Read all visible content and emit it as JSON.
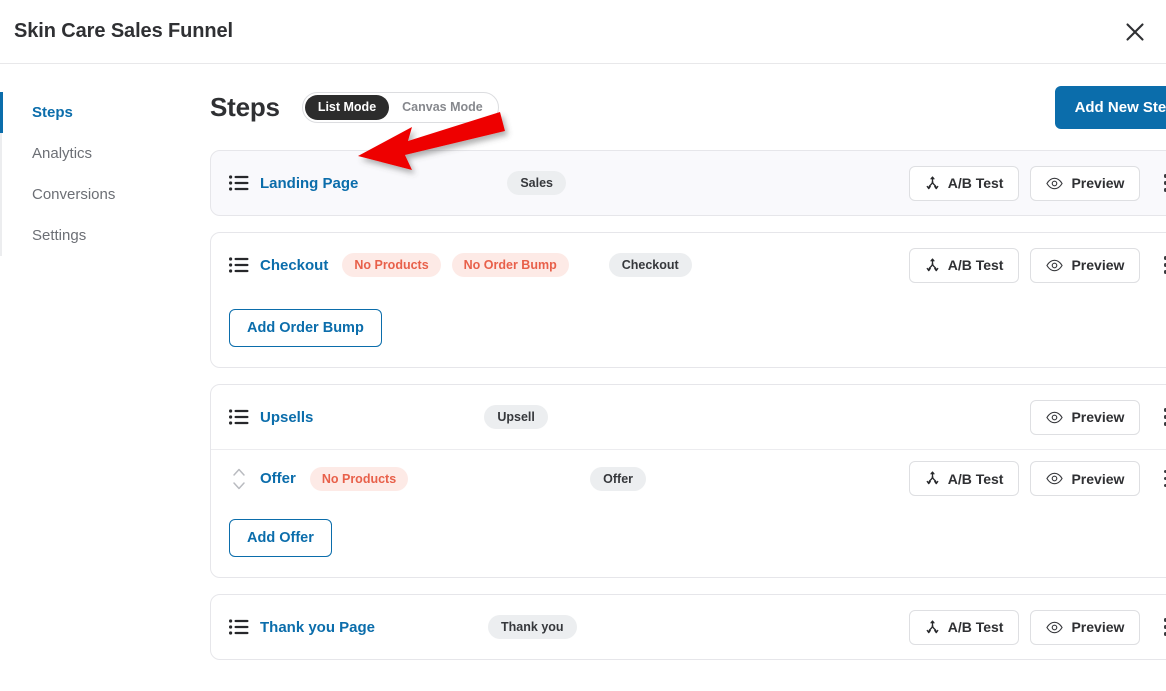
{
  "header": {
    "title": "Skin Care Sales Funnel",
    "close_icon": "close-icon"
  },
  "sidebar": {
    "items": [
      {
        "label": "Steps",
        "active": true
      },
      {
        "label": "Analytics",
        "active": false
      },
      {
        "label": "Conversions",
        "active": false
      },
      {
        "label": "Settings",
        "active": false
      }
    ]
  },
  "toolbar": {
    "page_title": "Steps",
    "mode_toggle": {
      "options": [
        "List Mode",
        "Canvas Mode"
      ],
      "selected": "List Mode"
    },
    "add_new_step_label": "Add New Step"
  },
  "labels": {
    "ab_test": "A/B Test",
    "preview": "Preview",
    "add_order_bump": "Add Order Bump",
    "add_offer": "Add Offer"
  },
  "steps": [
    {
      "name": "Landing Page",
      "type_badge": "Sales",
      "warnings": [],
      "handle_icon": "list-lines-icon",
      "has_ab_test": true,
      "has_preview": true,
      "highlight": true,
      "footer": null,
      "sub_rows": []
    },
    {
      "name": "Checkout",
      "type_badge": "Checkout",
      "warnings": [
        "No Products",
        "No Order Bump"
      ],
      "handle_icon": "list-lines-icon",
      "has_ab_test": true,
      "has_preview": true,
      "highlight": false,
      "footer": "Add Order Bump",
      "sub_rows": []
    },
    {
      "name": "Upsells",
      "type_badge": "Upsell",
      "warnings": [],
      "handle_icon": "list-lines-icon",
      "has_ab_test": false,
      "has_preview": true,
      "highlight": false,
      "footer": "Add Offer",
      "sub_rows": [
        {
          "name": "Offer",
          "type_badge": "Offer",
          "warnings": [
            "No Products"
          ],
          "handle_icon": "sort-updown-icon",
          "has_ab_test": true,
          "has_preview": true
        }
      ]
    },
    {
      "name": "Thank you Page",
      "type_badge": "Thank you",
      "warnings": [],
      "handle_icon": "list-lines-icon",
      "has_ab_test": true,
      "has_preview": true,
      "highlight": false,
      "footer": null,
      "sub_rows": []
    }
  ],
  "annotation": {
    "type": "red-arrow",
    "color": "#EE0000",
    "points_to": "Landing Page"
  },
  "colors": {
    "brand_blue": "#0B6DAB",
    "warning_bg": "#FDEAE6",
    "warning_text": "#E8604A",
    "badge_bg": "#ECEEF0",
    "toggle_active_bg": "#2C2C2C"
  }
}
